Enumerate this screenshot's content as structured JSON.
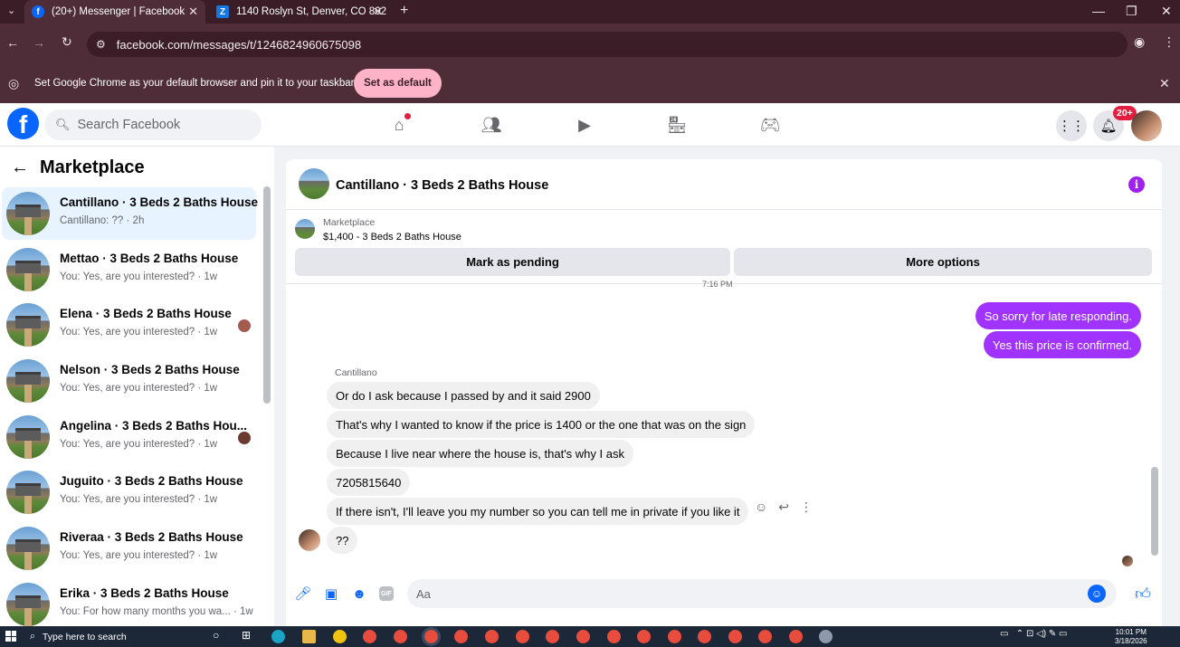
{
  "browser": {
    "tabs": [
      {
        "title": "(20+) Messenger | Facebook",
        "active": true
      },
      {
        "title": "1140 Roslyn St, Denver, CO 802",
        "active": false
      }
    ],
    "new_tab": "+",
    "url": "facebook.com/messages/t/1246824960675098",
    "infobar_text": "Set Google Chrome as your default browser and pin it to your taskbar",
    "infobar_button": "Set as default"
  },
  "header": {
    "search_placeholder": "Search Facebook",
    "notification_badge": "20+"
  },
  "left_panel": {
    "title": "Marketplace",
    "conversations": [
      {
        "name": "Cantillano · 3 Beds 2 Baths House",
        "preview": "Cantillano: ?? · 2h",
        "selected": true
      },
      {
        "name": "Mettao · 3 Beds 2 Baths House",
        "preview": "You: Yes, are you interested? · 1w"
      },
      {
        "name": "Elena · 3 Beds 2 Baths House",
        "preview": "You: Yes, are you interested? · 1w"
      },
      {
        "name": "Nelson · 3 Beds 2 Baths House",
        "preview": "You: Yes, are you interested? · 1w"
      },
      {
        "name": "Angelina · 3 Beds 2 Baths Hou...",
        "preview": "You: Yes, are you interested? · 1w"
      },
      {
        "name": "Juguito · 3 Beds 2 Baths House",
        "preview": "You: Yes, are you interested? · 1w"
      },
      {
        "name": "Riveraa · 3 Beds 2 Baths House",
        "preview": "You: Yes, are you interested? · 1w"
      },
      {
        "name": "Erika · 3 Beds 2 Baths House",
        "preview": "You: For how many months you wa... · 1w"
      }
    ]
  },
  "chat": {
    "title": "Cantillano · 3 Beds 2 Baths House",
    "marketplace_label": "Marketplace",
    "listing": "$1,400 - 3 Beds 2 Baths House",
    "mark_pending": "Mark as pending",
    "more_options": "More options",
    "time_divider": "7:16 PM",
    "outgoing": [
      "So sorry for late responding.",
      "Yes this price is confirmed."
    ],
    "sender_name": "Cantillano",
    "incoming": [
      "Or do I ask because I passed by and it said 2900",
      "That's why I wanted to know if the price is 1400 or the one that was on the sign",
      "Because I live near where the house is, that's why I ask",
      "7205815640",
      "If there isn't, I'll leave you my number so you can tell me in private if you like it",
      "??"
    ],
    "composer_placeholder": "Aa",
    "gif_label": "GIF"
  },
  "taskbar": {
    "search_text": "Type here to search",
    "time": "10:01 PM",
    "date": "3/18/2026"
  }
}
